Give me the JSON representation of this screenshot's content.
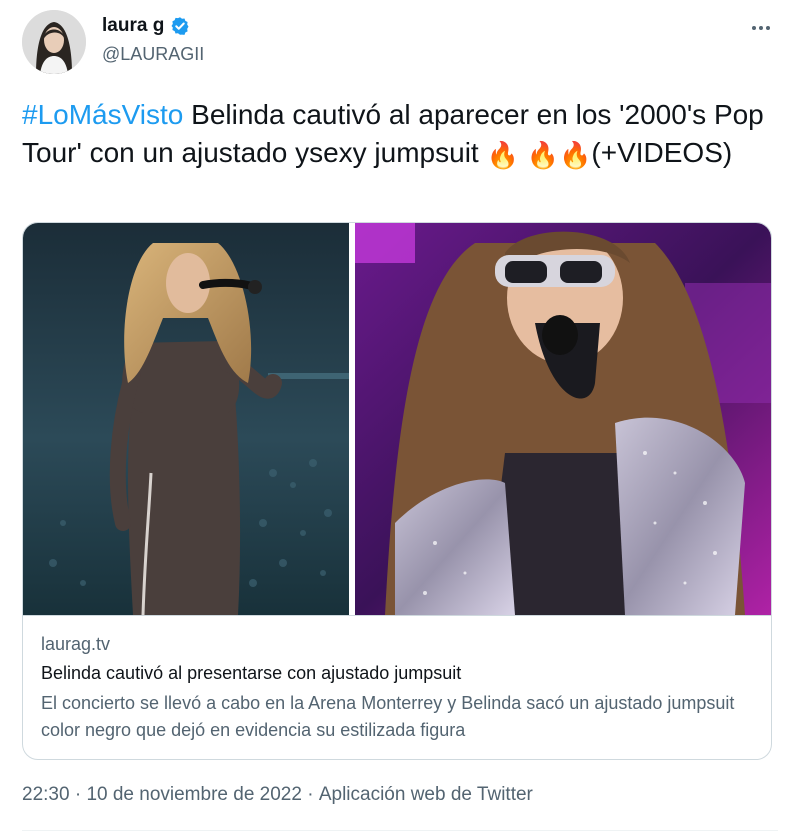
{
  "author": {
    "display_name": "laura g",
    "handle": "@LAURAGII",
    "verified_icon": "verified-badge-icon",
    "badge_color": "#1d9bf0"
  },
  "tweet": {
    "hashtag": "#LoMásVisto",
    "body": " Belinda cautivó al aparecer en los '2000's Pop Tour' con un ajustado ysexy jumpsuit ",
    "emoji_1": "🔥",
    "emoji_2": "🔥",
    "emoji_3": "🔥",
    "suffix": "(+VIDEOS)"
  },
  "link_card": {
    "domain": "laurag.tv",
    "title": "Belinda cautivó al presentarse con ajustado jumpsuit",
    "description": "El concierto se llevó a cabo en la Arena Monterrey y Belinda sacó un ajustado jumpsuit color negro que dejó en evidencia su estilizada figura"
  },
  "meta": {
    "time": "22:30",
    "separator": " · ",
    "date": "10 de noviembre de 2022",
    "source": "Aplicación web de Twitter"
  },
  "colors": {
    "link_blue": "#1d9bf0",
    "text_primary": "#0f1419",
    "text_secondary": "#536471",
    "border": "#cfd9de"
  }
}
